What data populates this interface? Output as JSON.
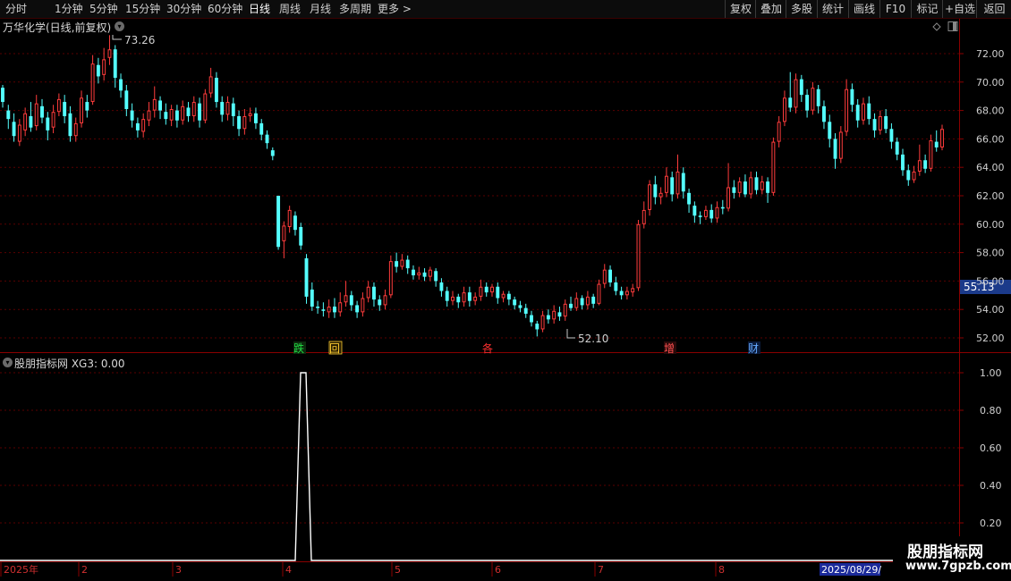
{
  "toolbar": {
    "periods": [
      "分时",
      "1分钟",
      "5分钟",
      "15分钟",
      "30分钟",
      "60分钟",
      "日线",
      "周线",
      "月线",
      "多周期",
      "更多 >"
    ],
    "active_period": "日线",
    "right_buttons": [
      "复权",
      "叠加",
      "多股",
      "统计",
      "画线",
      "F10",
      "标记",
      "+自选",
      "返回"
    ]
  },
  "main_chart": {
    "title": "万华化学(日线,前复权)",
    "high_label": "73.26",
    "low_label": "52.10",
    "current_price": "55.13",
    "y_ticks": [
      "72.00",
      "70.00",
      "68.00",
      "66.00",
      "64.00",
      "62.00",
      "60.00",
      "58.00",
      "56.00",
      "54.00",
      "52.00"
    ],
    "signals": [
      {
        "label": "跌",
        "color": "#22dd44"
      },
      {
        "label": "回",
        "color": "#ffcc33"
      },
      {
        "label": "各",
        "color": "#ff3030"
      },
      {
        "label": "增",
        "color": "#ff3030"
      },
      {
        "label": "财",
        "color": "#66aaff"
      }
    ]
  },
  "indicator": {
    "title": "股朋指标网 XG3: 0.00",
    "y_ticks": [
      "1.00",
      "0.80",
      "0.60",
      "0.40",
      "0.20"
    ]
  },
  "x_axis": {
    "labels": [
      "2025年",
      "2",
      "3",
      "4",
      "5",
      "6",
      "7",
      "8"
    ],
    "cursor_date": "2025/08/29/"
  },
  "watermark": {
    "name": "股朋指标网",
    "url": "www.7gpzb.com"
  },
  "chart_data": {
    "type": "candlestick",
    "ylim": [
      51,
      74
    ],
    "candles": [
      {
        "o": 69.6,
        "c": 68.6,
        "h": 69.8,
        "l": 68.2
      },
      {
        "o": 68.0,
        "c": 67.4,
        "h": 68.4,
        "l": 66.7
      },
      {
        "o": 67.2,
        "c": 66.2,
        "h": 67.8,
        "l": 65.8
      },
      {
        "o": 65.8,
        "c": 67.0,
        "h": 67.4,
        "l": 65.5
      },
      {
        "o": 66.6,
        "c": 67.8,
        "h": 68.2,
        "l": 66.2
      },
      {
        "o": 67.6,
        "c": 66.8,
        "h": 68.6,
        "l": 66.5
      },
      {
        "o": 66.9,
        "c": 68.5,
        "h": 69.1,
        "l": 66.6
      },
      {
        "o": 68.3,
        "c": 67.5,
        "h": 68.8,
        "l": 67.1
      },
      {
        "o": 67.5,
        "c": 66.6,
        "h": 67.9,
        "l": 65.9
      },
      {
        "o": 66.8,
        "c": 67.9,
        "h": 68.4,
        "l": 66.4
      },
      {
        "o": 67.9,
        "c": 68.8,
        "h": 69.2,
        "l": 67.6
      },
      {
        "o": 68.6,
        "c": 67.6,
        "h": 69.1,
        "l": 67.1
      },
      {
        "o": 67.8,
        "c": 66.2,
        "h": 68.3,
        "l": 65.8
      },
      {
        "o": 66.2,
        "c": 67.1,
        "h": 67.5,
        "l": 65.8
      },
      {
        "o": 67.1,
        "c": 68.9,
        "h": 69.4,
        "l": 66.8
      },
      {
        "o": 68.6,
        "c": 68.0,
        "h": 69.1,
        "l": 67.5
      },
      {
        "o": 68.6,
        "c": 71.3,
        "h": 71.9,
        "l": 68.4
      },
      {
        "o": 71.2,
        "c": 70.4,
        "h": 71.7,
        "l": 69.9
      },
      {
        "o": 70.5,
        "c": 71.6,
        "h": 72.4,
        "l": 70.1
      },
      {
        "o": 71.7,
        "c": 72.3,
        "h": 73.3,
        "l": 71.2
      },
      {
        "o": 72.3,
        "c": 70.3,
        "h": 72.6,
        "l": 69.6
      },
      {
        "o": 70.2,
        "c": 69.4,
        "h": 70.6,
        "l": 68.9
      },
      {
        "o": 69.4,
        "c": 68.1,
        "h": 69.8,
        "l": 67.6
      },
      {
        "o": 68.0,
        "c": 67.3,
        "h": 68.5,
        "l": 66.8
      },
      {
        "o": 67.1,
        "c": 66.6,
        "h": 67.5,
        "l": 66.1
      },
      {
        "o": 66.5,
        "c": 67.4,
        "h": 67.8,
        "l": 66.1
      },
      {
        "o": 67.3,
        "c": 68.0,
        "h": 68.6,
        "l": 66.9
      },
      {
        "o": 68.0,
        "c": 68.8,
        "h": 69.7,
        "l": 67.5
      },
      {
        "o": 68.7,
        "c": 68.0,
        "h": 69.0,
        "l": 67.4
      },
      {
        "o": 67.9,
        "c": 67.4,
        "h": 68.5,
        "l": 67.0
      },
      {
        "o": 67.3,
        "c": 68.1,
        "h": 68.4,
        "l": 66.9
      },
      {
        "o": 68.0,
        "c": 67.3,
        "h": 68.4,
        "l": 66.8
      },
      {
        "o": 67.3,
        "c": 68.3,
        "h": 68.7,
        "l": 67.0
      },
      {
        "o": 68.2,
        "c": 67.6,
        "h": 68.6,
        "l": 67.2
      },
      {
        "o": 67.6,
        "c": 68.6,
        "h": 69.0,
        "l": 67.2
      },
      {
        "o": 68.5,
        "c": 67.3,
        "h": 68.9,
        "l": 66.8
      },
      {
        "o": 67.3,
        "c": 69.2,
        "h": 69.5,
        "l": 67.1
      },
      {
        "o": 69.2,
        "c": 70.4,
        "h": 71.0,
        "l": 68.9
      },
      {
        "o": 70.3,
        "c": 68.6,
        "h": 70.7,
        "l": 68.2
      },
      {
        "o": 68.6,
        "c": 67.7,
        "h": 69.0,
        "l": 67.2
      },
      {
        "o": 67.7,
        "c": 68.6,
        "h": 69.0,
        "l": 67.3
      },
      {
        "o": 68.5,
        "c": 67.6,
        "h": 68.9,
        "l": 66.9
      },
      {
        "o": 67.6,
        "c": 66.7,
        "h": 68.0,
        "l": 66.2
      },
      {
        "o": 66.7,
        "c": 67.6,
        "h": 68.1,
        "l": 66.3
      },
      {
        "o": 67.6,
        "c": 67.8,
        "h": 68.2,
        "l": 67.2
      },
      {
        "o": 67.8,
        "c": 67.1,
        "h": 68.2,
        "l": 66.7
      },
      {
        "o": 67.1,
        "c": 66.3,
        "h": 67.4,
        "l": 65.9
      },
      {
        "o": 66.3,
        "c": 65.7,
        "h": 66.6,
        "l": 65.3
      },
      {
        "o": 65.2,
        "c": 64.8,
        "h": 65.4,
        "l": 64.5
      },
      {
        "o": 62.0,
        "c": 58.4,
        "h": 62.0,
        "l": 58.2
      },
      {
        "o": 58.8,
        "c": 59.9,
        "h": 60.2,
        "l": 57.6
      },
      {
        "o": 59.8,
        "c": 61.0,
        "h": 61.3,
        "l": 59.4
      },
      {
        "o": 60.6,
        "c": 59.6,
        "h": 60.9,
        "l": 59.2
      },
      {
        "o": 59.8,
        "c": 58.5,
        "h": 60.1,
        "l": 58.2
      },
      {
        "o": 57.6,
        "c": 54.9,
        "h": 57.9,
        "l": 54.4
      },
      {
        "o": 55.4,
        "c": 54.2,
        "h": 55.9,
        "l": 53.9
      },
      {
        "o": 54.2,
        "c": 54.1,
        "h": 54.6,
        "l": 53.7
      },
      {
        "o": 54.0,
        "c": 53.9,
        "h": 54.5,
        "l": 53.5
      },
      {
        "o": 53.8,
        "c": 54.2,
        "h": 54.7,
        "l": 53.4
      },
      {
        "o": 54.2,
        "c": 53.8,
        "h": 54.8,
        "l": 53.4
      },
      {
        "o": 53.8,
        "c": 54.5,
        "h": 55.2,
        "l": 53.5
      },
      {
        "o": 54.5,
        "c": 55.0,
        "h": 56.0,
        "l": 54.2
      },
      {
        "o": 55.0,
        "c": 54.3,
        "h": 55.3,
        "l": 53.9
      },
      {
        "o": 54.3,
        "c": 53.8,
        "h": 54.6,
        "l": 53.4
      },
      {
        "o": 53.8,
        "c": 54.8,
        "h": 55.2,
        "l": 53.5
      },
      {
        "o": 54.8,
        "c": 55.6,
        "h": 56.0,
        "l": 54.5
      },
      {
        "o": 55.6,
        "c": 54.7,
        "h": 55.9,
        "l": 54.2
      },
      {
        "o": 54.7,
        "c": 54.3,
        "h": 55.0,
        "l": 53.9
      },
      {
        "o": 54.3,
        "c": 55.0,
        "h": 55.4,
        "l": 54.0
      },
      {
        "o": 55.0,
        "c": 57.4,
        "h": 57.8,
        "l": 54.8
      },
      {
        "o": 57.4,
        "c": 57.0,
        "h": 58.0,
        "l": 56.6
      },
      {
        "o": 57.0,
        "c": 57.5,
        "h": 57.9,
        "l": 56.8
      },
      {
        "o": 57.5,
        "c": 56.9,
        "h": 57.8,
        "l": 56.5
      },
      {
        "o": 56.8,
        "c": 56.4,
        "h": 57.1,
        "l": 56.1
      },
      {
        "o": 56.4,
        "c": 56.6,
        "h": 57.0,
        "l": 56.1
      },
      {
        "o": 56.6,
        "c": 56.3,
        "h": 56.9,
        "l": 56.0
      },
      {
        "o": 56.3,
        "c": 56.8,
        "h": 57.0,
        "l": 56.0
      },
      {
        "o": 56.7,
        "c": 56.0,
        "h": 56.9,
        "l": 55.6
      },
      {
        "o": 55.9,
        "c": 55.3,
        "h": 56.2,
        "l": 54.9
      },
      {
        "o": 55.3,
        "c": 54.6,
        "h": 55.6,
        "l": 54.2
      },
      {
        "o": 54.6,
        "c": 54.9,
        "h": 55.3,
        "l": 54.3
      },
      {
        "o": 54.9,
        "c": 54.5,
        "h": 55.1,
        "l": 54.1
      },
      {
        "o": 54.5,
        "c": 55.2,
        "h": 55.6,
        "l": 54.2
      },
      {
        "o": 55.2,
        "c": 54.6,
        "h": 55.6,
        "l": 54.2
      },
      {
        "o": 54.6,
        "c": 54.9,
        "h": 55.2,
        "l": 54.3
      },
      {
        "o": 54.9,
        "c": 55.6,
        "h": 56.1,
        "l": 54.6
      },
      {
        "o": 55.6,
        "c": 55.2,
        "h": 55.9,
        "l": 54.9
      },
      {
        "o": 55.2,
        "c": 55.6,
        "h": 55.8,
        "l": 54.9
      },
      {
        "o": 55.6,
        "c": 54.8,
        "h": 55.9,
        "l": 54.4
      },
      {
        "o": 54.8,
        "c": 55.1,
        "h": 55.3,
        "l": 54.5
      },
      {
        "o": 55.1,
        "c": 54.7,
        "h": 55.3,
        "l": 54.3
      },
      {
        "o": 54.7,
        "c": 54.3,
        "h": 54.9,
        "l": 54.0
      },
      {
        "o": 54.3,
        "c": 54.1,
        "h": 54.6,
        "l": 53.8
      },
      {
        "o": 54.1,
        "c": 53.7,
        "h": 54.4,
        "l": 53.4
      },
      {
        "o": 53.6,
        "c": 53.1,
        "h": 53.9,
        "l": 52.8
      },
      {
        "o": 53.0,
        "c": 52.6,
        "h": 53.2,
        "l": 52.1
      },
      {
        "o": 52.6,
        "c": 53.6,
        "h": 53.9,
        "l": 52.4
      },
      {
        "o": 53.6,
        "c": 53.3,
        "h": 54.0,
        "l": 53.0
      },
      {
        "o": 53.3,
        "c": 53.9,
        "h": 54.3,
        "l": 53.0
      },
      {
        "o": 53.8,
        "c": 53.5,
        "h": 54.2,
        "l": 53.2
      },
      {
        "o": 53.5,
        "c": 54.4,
        "h": 54.7,
        "l": 53.2
      },
      {
        "o": 54.4,
        "c": 54.1,
        "h": 54.9,
        "l": 53.9
      },
      {
        "o": 54.1,
        "c": 54.8,
        "h": 55.2,
        "l": 53.9
      },
      {
        "o": 54.8,
        "c": 54.3,
        "h": 55.0,
        "l": 54.0
      },
      {
        "o": 54.3,
        "c": 54.9,
        "h": 55.3,
        "l": 54.0
      },
      {
        "o": 54.9,
        "c": 54.4,
        "h": 55.1,
        "l": 54.1
      },
      {
        "o": 54.4,
        "c": 55.8,
        "h": 56.1,
        "l": 54.3
      },
      {
        "o": 55.8,
        "c": 56.8,
        "h": 57.2,
        "l": 55.5
      },
      {
        "o": 56.8,
        "c": 55.9,
        "h": 57.1,
        "l": 55.6
      },
      {
        "o": 55.9,
        "c": 55.3,
        "h": 56.3,
        "l": 55.0
      },
      {
        "o": 55.3,
        "c": 55.0,
        "h": 55.6,
        "l": 54.7
      },
      {
        "o": 55.0,
        "c": 55.3,
        "h": 55.6,
        "l": 54.7
      },
      {
        "o": 55.2,
        "c": 55.5,
        "h": 55.8,
        "l": 54.9
      },
      {
        "o": 55.5,
        "c": 60.0,
        "h": 60.3,
        "l": 55.3
      },
      {
        "o": 60.0,
        "c": 61.0,
        "h": 61.6,
        "l": 59.7
      },
      {
        "o": 61.0,
        "c": 62.8,
        "h": 63.1,
        "l": 60.6
      },
      {
        "o": 62.8,
        "c": 61.9,
        "h": 63.4,
        "l": 61.4
      },
      {
        "o": 61.9,
        "c": 62.2,
        "h": 62.6,
        "l": 61.4
      },
      {
        "o": 62.2,
        "c": 63.4,
        "h": 64.0,
        "l": 61.9
      },
      {
        "o": 63.3,
        "c": 62.1,
        "h": 63.7,
        "l": 61.6
      },
      {
        "o": 62.1,
        "c": 63.7,
        "h": 64.9,
        "l": 61.8
      },
      {
        "o": 63.6,
        "c": 62.3,
        "h": 64.0,
        "l": 61.8
      },
      {
        "o": 62.2,
        "c": 61.4,
        "h": 62.5,
        "l": 60.8
      },
      {
        "o": 61.3,
        "c": 60.6,
        "h": 61.6,
        "l": 60.1
      },
      {
        "o": 60.6,
        "c": 60.5,
        "h": 60.9,
        "l": 60.0
      },
      {
        "o": 60.5,
        "c": 61.0,
        "h": 61.3,
        "l": 60.3
      },
      {
        "o": 61.0,
        "c": 60.4,
        "h": 61.4,
        "l": 60.1
      },
      {
        "o": 60.4,
        "c": 61.2,
        "h": 61.6,
        "l": 60.1
      },
      {
        "o": 61.2,
        "c": 61.1,
        "h": 61.7,
        "l": 60.7
      },
      {
        "o": 61.1,
        "c": 62.6,
        "h": 64.3,
        "l": 60.9
      },
      {
        "o": 62.6,
        "c": 62.2,
        "h": 63.1,
        "l": 61.8
      },
      {
        "o": 62.2,
        "c": 63.0,
        "h": 63.3,
        "l": 61.9
      },
      {
        "o": 63.0,
        "c": 62.1,
        "h": 63.5,
        "l": 61.9
      },
      {
        "o": 62.1,
        "c": 63.3,
        "h": 63.7,
        "l": 61.8
      },
      {
        "o": 63.3,
        "c": 62.4,
        "h": 63.7,
        "l": 62.1
      },
      {
        "o": 62.4,
        "c": 63.0,
        "h": 63.4,
        "l": 62.1
      },
      {
        "o": 63.0,
        "c": 62.2,
        "h": 63.3,
        "l": 61.5
      },
      {
        "o": 62.2,
        "c": 65.8,
        "h": 66.1,
        "l": 62.0
      },
      {
        "o": 65.8,
        "c": 67.2,
        "h": 67.6,
        "l": 65.4
      },
      {
        "o": 67.2,
        "c": 68.9,
        "h": 69.4,
        "l": 66.9
      },
      {
        "o": 68.9,
        "c": 68.2,
        "h": 70.7,
        "l": 67.9
      },
      {
        "o": 68.2,
        "c": 70.2,
        "h": 70.6,
        "l": 67.8
      },
      {
        "o": 70.2,
        "c": 69.1,
        "h": 70.5,
        "l": 68.6
      },
      {
        "o": 69.1,
        "c": 68.0,
        "h": 69.5,
        "l": 67.5
      },
      {
        "o": 68.0,
        "c": 69.6,
        "h": 70.0,
        "l": 67.7
      },
      {
        "o": 69.5,
        "c": 68.3,
        "h": 69.8,
        "l": 67.8
      },
      {
        "o": 68.3,
        "c": 67.2,
        "h": 68.7,
        "l": 66.7
      },
      {
        "o": 67.2,
        "c": 66.0,
        "h": 67.7,
        "l": 65.4
      },
      {
        "o": 66.0,
        "c": 64.6,
        "h": 66.4,
        "l": 63.9
      },
      {
        "o": 64.6,
        "c": 66.5,
        "h": 66.9,
        "l": 64.3
      },
      {
        "o": 66.5,
        "c": 69.5,
        "h": 70.2,
        "l": 66.2
      },
      {
        "o": 69.5,
        "c": 68.4,
        "h": 69.9,
        "l": 67.9
      },
      {
        "o": 68.4,
        "c": 67.3,
        "h": 68.8,
        "l": 66.8
      },
      {
        "o": 67.3,
        "c": 68.5,
        "h": 68.9,
        "l": 67.0
      },
      {
        "o": 68.5,
        "c": 67.4,
        "h": 69.0,
        "l": 67.0
      },
      {
        "o": 67.4,
        "c": 66.6,
        "h": 67.8,
        "l": 66.1
      },
      {
        "o": 66.6,
        "c": 67.6,
        "h": 68.0,
        "l": 66.3
      },
      {
        "o": 67.6,
        "c": 66.7,
        "h": 68.1,
        "l": 66.4
      },
      {
        "o": 66.7,
        "c": 65.8,
        "h": 67.1,
        "l": 65.3
      },
      {
        "o": 65.8,
        "c": 64.9,
        "h": 66.1,
        "l": 64.5
      },
      {
        "o": 64.9,
        "c": 63.8,
        "h": 65.3,
        "l": 63.4
      },
      {
        "o": 63.8,
        "c": 63.1,
        "h": 64.2,
        "l": 62.7
      },
      {
        "o": 63.1,
        "c": 63.7,
        "h": 64.1,
        "l": 62.9
      },
      {
        "o": 63.7,
        "c": 64.5,
        "h": 65.6,
        "l": 63.4
      },
      {
        "o": 64.5,
        "c": 63.9,
        "h": 64.9,
        "l": 63.6
      },
      {
        "o": 63.9,
        "c": 65.9,
        "h": 66.3,
        "l": 63.7
      },
      {
        "o": 65.8,
        "c": 65.4,
        "h": 66.6,
        "l": 65.1
      },
      {
        "o": 65.4,
        "c": 66.7,
        "h": 67.0,
        "l": 65.2
      }
    ],
    "indicator": {
      "name": "XG3",
      "values": [
        0,
        1,
        1,
        0
      ]
    }
  }
}
